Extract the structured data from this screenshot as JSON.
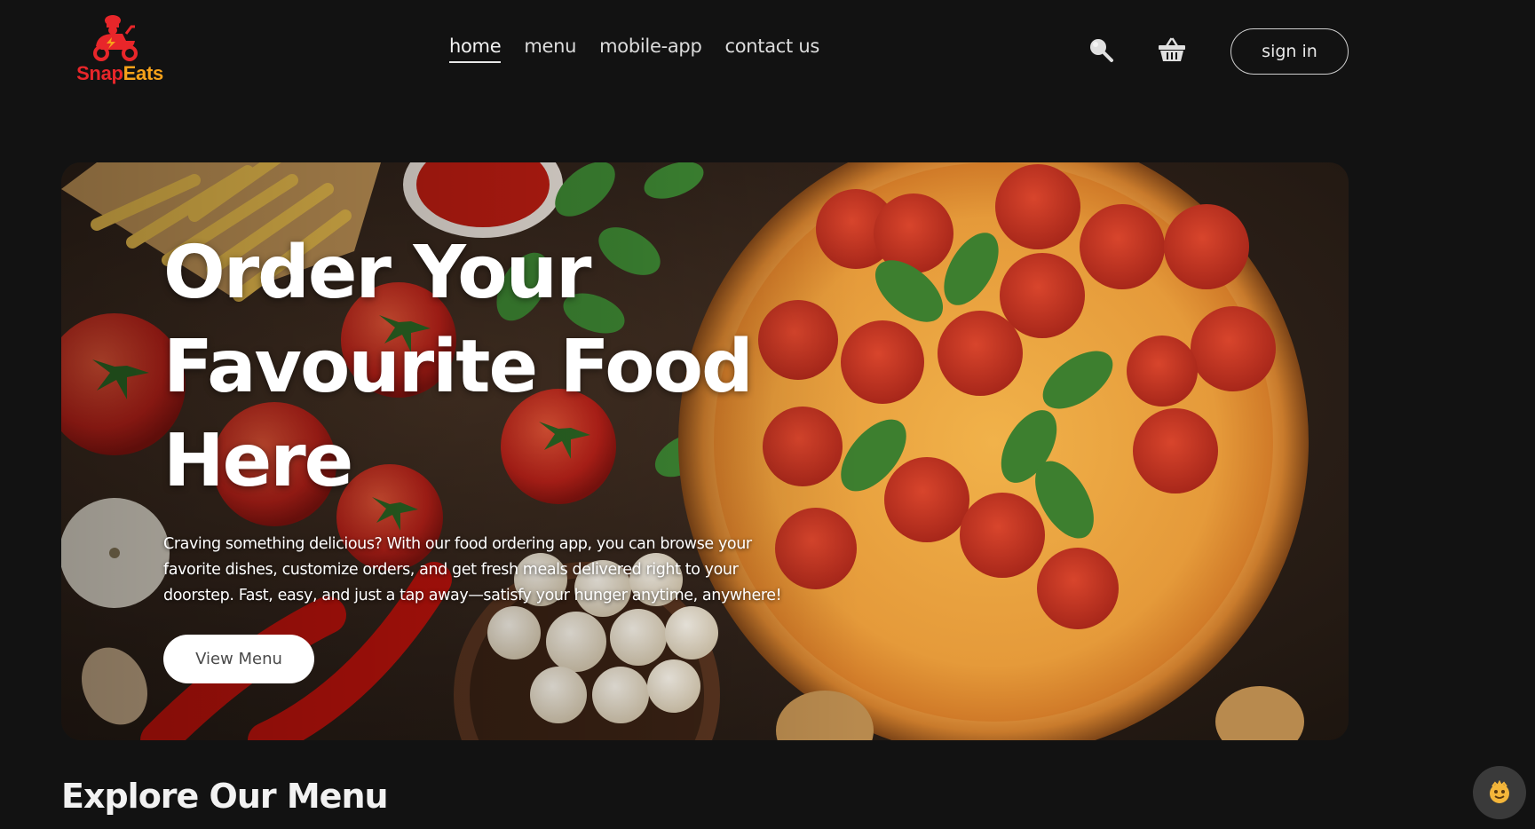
{
  "brand": {
    "name_part1": "Snap",
    "name_part2": "Eats",
    "logo_icon": "scooter-chef-icon",
    "colors": {
      "red": "#e8262a",
      "orange": "#f6a21a"
    }
  },
  "nav": {
    "links": [
      {
        "label": "home",
        "active": true
      },
      {
        "label": "menu",
        "active": false
      },
      {
        "label": "mobile-app",
        "active": false
      },
      {
        "label": "contact us",
        "active": false
      }
    ],
    "search_icon": "search-icon",
    "basket_icon": "basket-icon",
    "signin_label": "sign in"
  },
  "hero": {
    "title_line1": "Order Your",
    "title_line2": "Favourite Food",
    "title_line3": "Here",
    "description": "Craving something delicious? With our food ordering app, you can browse your favorite dishes, customize orders, and get fresh meals delivered right to your doorstep. Fast, easy, and just a tap away—satisfy your hunger anytime, anywhere!",
    "cta_label": "View Menu"
  },
  "section": {
    "explore_title": "Explore Our Menu"
  },
  "chat": {
    "icon": "chatbot-face-icon"
  },
  "colors": {
    "background": "#121212",
    "text": "#e8e8e8"
  }
}
